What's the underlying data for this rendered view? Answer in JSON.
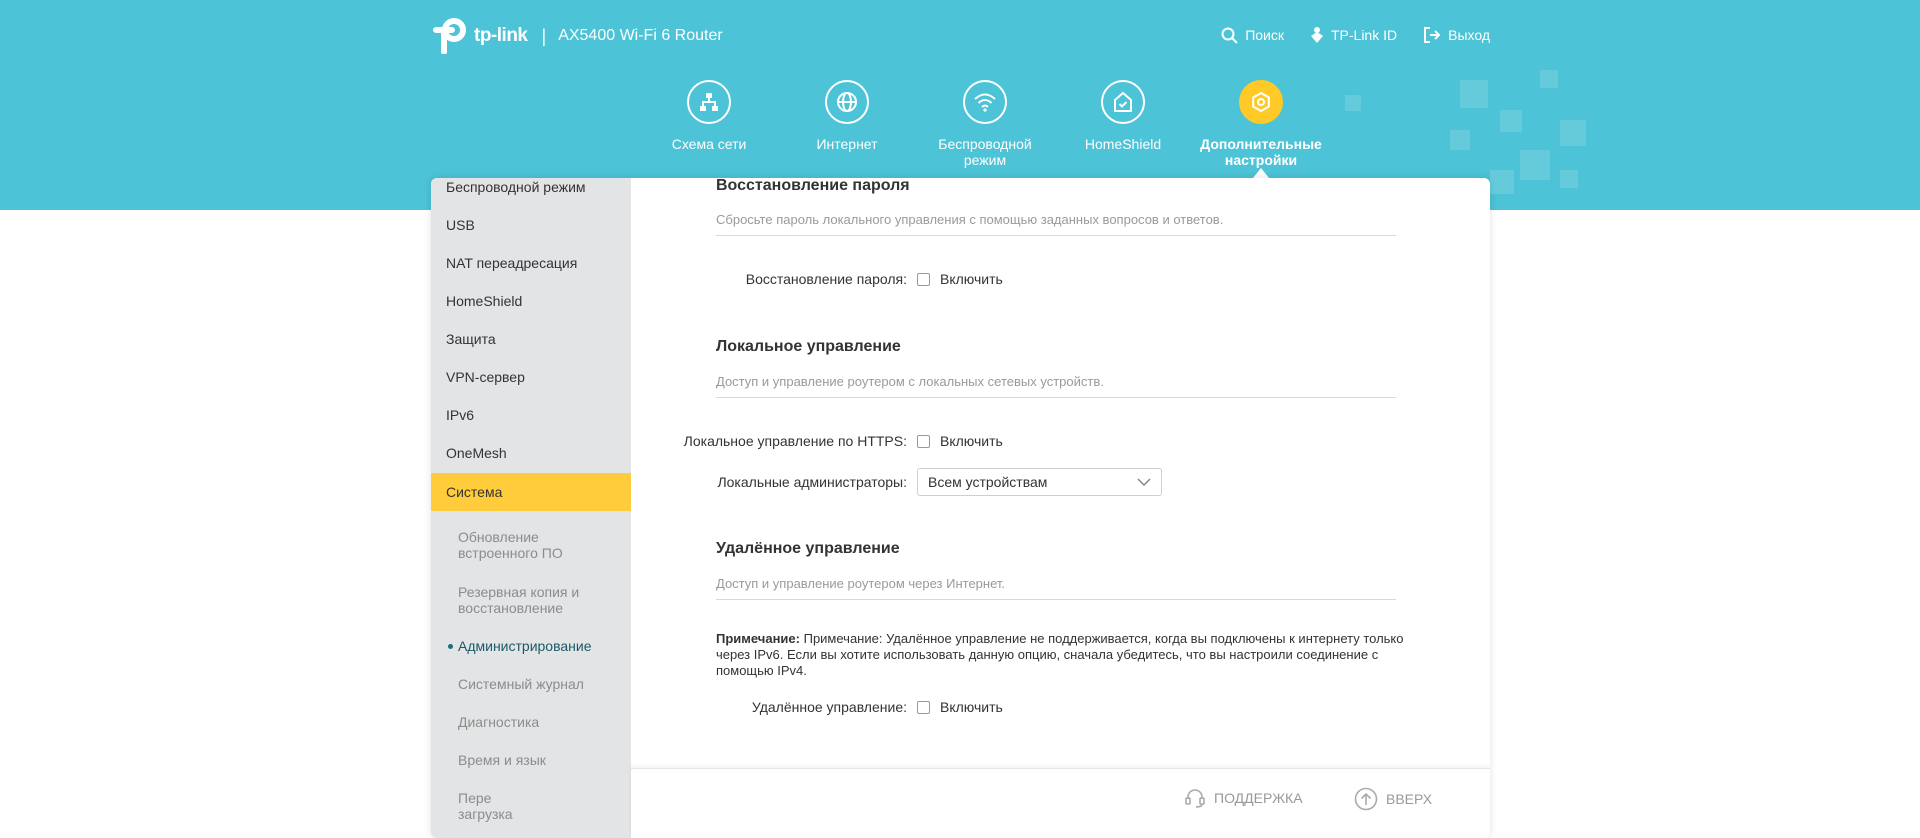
{
  "header": {
    "brand": "tp-link",
    "separator": "|",
    "model": "AX5400 Wi-Fi 6 Router",
    "links": [
      {
        "icon": "search-icon",
        "label": "Поиск"
      },
      {
        "icon": "tplink-id-icon",
        "label": "TP-Link ID"
      },
      {
        "icon": "logout-icon",
        "label": "Выход"
      }
    ]
  },
  "nav": {
    "items": [
      {
        "icon": "network-map-icon",
        "label": "Схема сети"
      },
      {
        "icon": "globe-icon",
        "label": "Интернет"
      },
      {
        "icon": "wifi-icon",
        "label": "Беспроводной режим"
      },
      {
        "icon": "homeshield-icon",
        "label": "HomeShield"
      },
      {
        "icon": "advanced-gear-icon",
        "label": "Дополнительные настройки",
        "active": true
      }
    ]
  },
  "sidebar": {
    "items": [
      "Беспроводной режим",
      "USB",
      "NAT переадресация",
      "HomeShield",
      "Защита",
      "VPN-сервер",
      "IPv6",
      "OneMesh",
      "Система"
    ],
    "active": "Система",
    "sub_items": [
      "Обновление встроенного ПО",
      "Резервная копия и восстановление",
      "Администрирование",
      "Системный журнал",
      "Диагностика",
      "Время и язык",
      "Пере загрузка"
    ],
    "sub_active": "Администрирование"
  },
  "content": {
    "password_recovery": {
      "title": "Восстановление пароля",
      "desc": "Сбросьте пароль локального управления с помощью заданных вопросов и ответов.",
      "row_label": "Восстановление пароля:",
      "checkbox_label": "Включить"
    },
    "local_management": {
      "title": "Локальное управление",
      "desc": "Доступ и управление роутером с локальных сетевых устройств.",
      "https_label": "Локальное управление по HTTPS:",
      "https_checkbox_label": "Включить",
      "admins_label": "Локальные администраторы:",
      "admins_value": "Всем устройствам"
    },
    "remote_management": {
      "title": "Удалённое управление",
      "desc": "Доступ и управление роутером через Интернет.",
      "note_bold": "Примечание:",
      "note_text": " Примечание: Удалённое управление не поддерживается, когда вы подключены к интернету только через IPv6. Если вы хотите использовать данную опцию, сначала убедитесь, что вы настроили соединение с помощью IPv4.",
      "row_label": "Удалённое управление:",
      "checkbox_label": "Включить"
    }
  },
  "footer": {
    "support": "ПОДДЕРЖКА",
    "top": "ВВЕРХ"
  },
  "colors": {
    "header_bg": "#4cc3d6",
    "accent_yellow": "#ffc928",
    "checkbox_border": "#4bb8cc"
  }
}
